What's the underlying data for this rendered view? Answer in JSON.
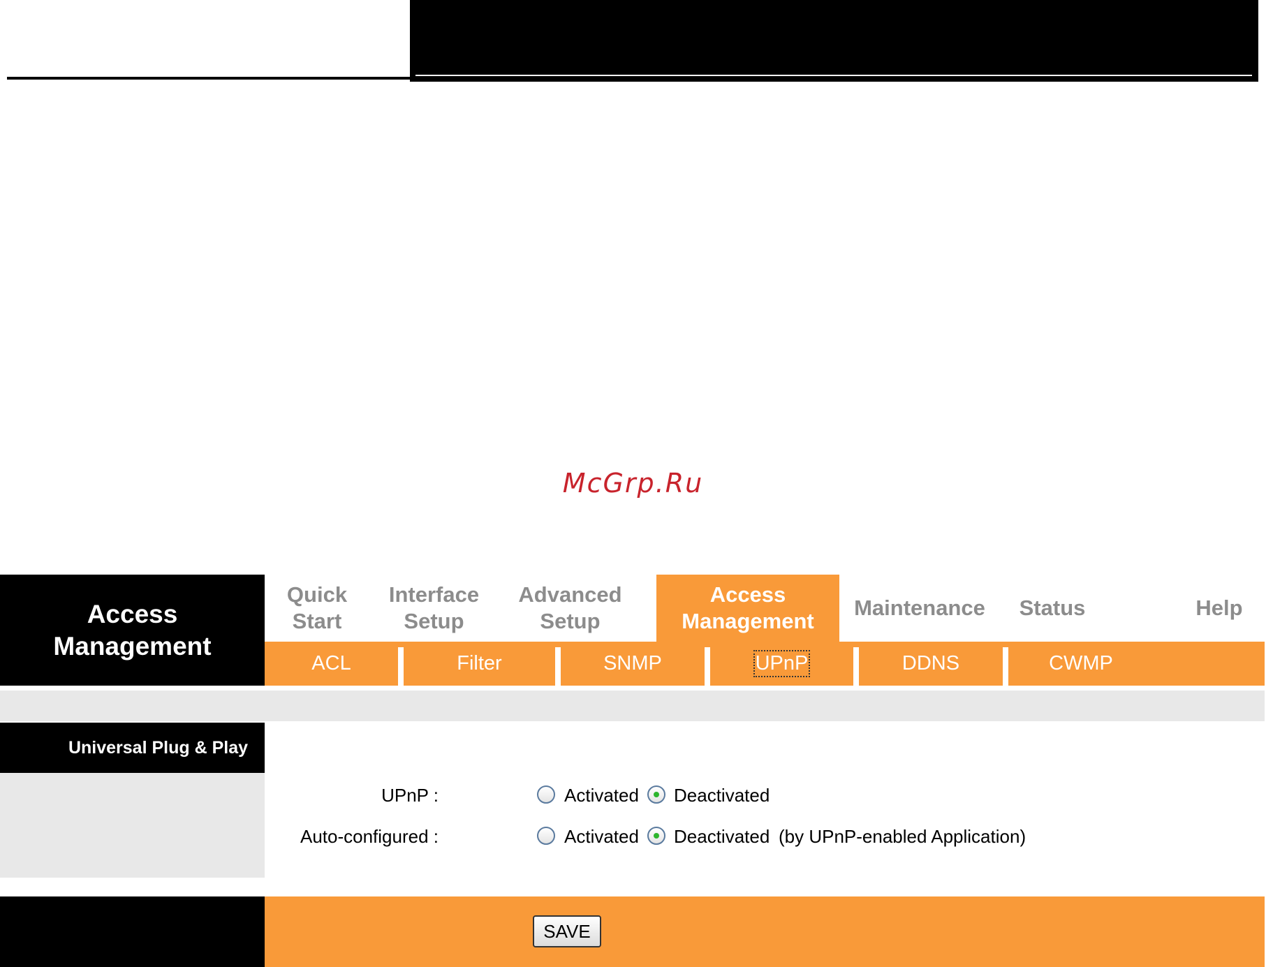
{
  "watermark": "McGrp.Ru",
  "section_title": "Access\nManagement",
  "top_nav": [
    {
      "label": "Quick\nStart",
      "active": false
    },
    {
      "label": "Interface\nSetup",
      "active": false
    },
    {
      "label": "Advanced\nSetup",
      "active": false
    },
    {
      "label": "Access\nManagement",
      "active": true
    },
    {
      "label": "Maintenance",
      "active": false
    },
    {
      "label": "Status",
      "active": false
    },
    {
      "label": "Help",
      "active": false
    }
  ],
  "sub_nav": [
    {
      "label": "ACL",
      "active": false
    },
    {
      "label": "Filter",
      "active": false
    },
    {
      "label": "SNMP",
      "active": false
    },
    {
      "label": "UPnP",
      "active": true
    },
    {
      "label": "DDNS",
      "active": false
    },
    {
      "label": "CWMP",
      "active": false
    }
  ],
  "panel_label": "Universal Plug & Play",
  "settings": {
    "upnp": {
      "label": "UPnP :",
      "options": [
        "Activated",
        "Deactivated"
      ],
      "selected": "Deactivated"
    },
    "auto_configured": {
      "label": "Auto-configured :",
      "options": [
        "Activated",
        "Deactivated"
      ],
      "selected": "Deactivated",
      "note": "(by UPnP-enabled Application)"
    }
  },
  "save_label": "SAVE",
  "colors": {
    "accent": "#f99a39",
    "header": "#000000",
    "panel_grey": "#e8e8e8",
    "watermark": "#c8232c"
  }
}
